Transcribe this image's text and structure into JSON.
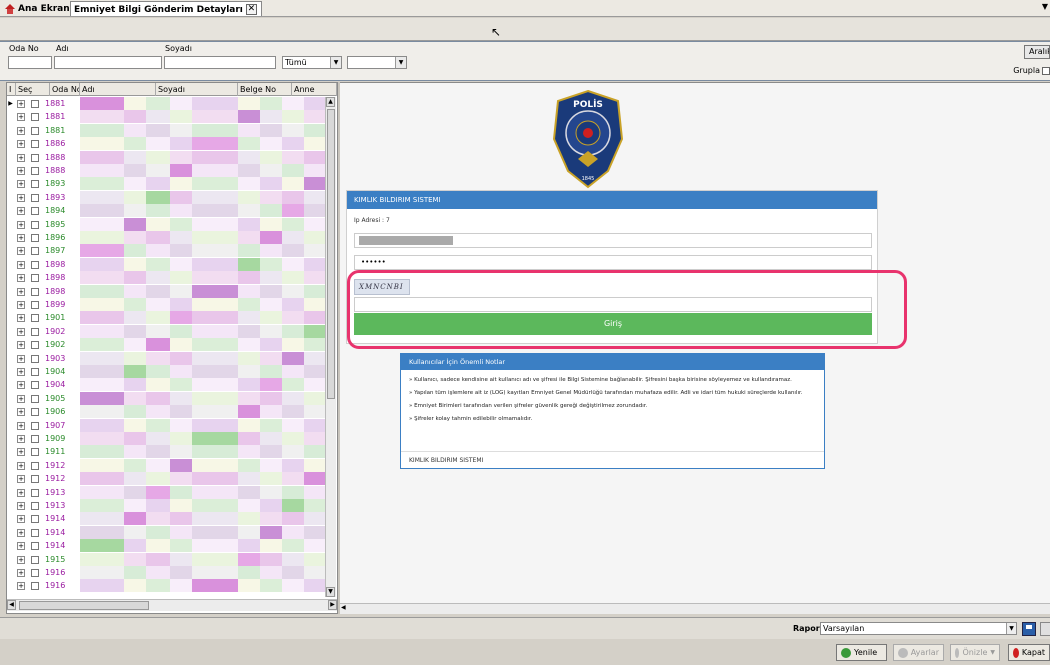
{
  "tabs": [
    {
      "label": "Ana Ekran",
      "icon": "home-icon"
    },
    {
      "label": "Emniyet Bilgi Gönderim Detayları",
      "close": "✕"
    }
  ],
  "filters": {
    "labels": {
      "oda_no": "Oda No",
      "adi": "Adı",
      "soyadi": "Soyadı"
    },
    "status_select": "Tümü",
    "range_button": "Aralık",
    "group_label": "Grupla"
  },
  "grid": {
    "columns": [
      "Seç",
      "Oda No",
      "Adı",
      "Soyadı",
      "Belge No",
      "Anne"
    ],
    "room_numbers": [
      "1881",
      "1881",
      "1881",
      "1886",
      "1888",
      "1888",
      "1893",
      "1893",
      "1894",
      "1895",
      "1896",
      "1897",
      "1898",
      "1898",
      "1898",
      "1899",
      "1901",
      "1902",
      "1902",
      "1903",
      "1904",
      "1904",
      "1905",
      "1906",
      "1907",
      "1909",
      "1911",
      "1912",
      "1912",
      "1913",
      "1913",
      "1914",
      "1914",
      "1914",
      "1915",
      "1916",
      "1916"
    ],
    "room_colors": [
      "#9a1ba0",
      "#9a1ba0",
      "#2a8a2a",
      "#9a1ba0",
      "#9a1ba0",
      "#9a1ba0",
      "#2a8a2a",
      "#9a1ba0",
      "#2a8a2a",
      "#2a8a2a",
      "#2a8a2a",
      "#2a8a2a",
      "#9a1ba0",
      "#9a1ba0",
      "#9a1ba0",
      "#9a1ba0",
      "#2a8a2a",
      "#9a1ba0",
      "#2a8a2a",
      "#9a1ba0",
      "#2a8a2a",
      "#9a1ba0",
      "#2a8a2a",
      "#2a8a2a",
      "#9a1ba0",
      "#2a8a2a",
      "#2a8a2a",
      "#9a1ba0",
      "#9a1ba0",
      "#9a1ba0",
      "#9a1ba0",
      "#9a1ba0",
      "#9a1ba0",
      "#9a1ba0",
      "#2a8a2a",
      "#9a1ba0",
      "#9a1ba0"
    ]
  },
  "web": {
    "card_title": "KIMLIK BILDIRIM SISTEMI",
    "ip_label": "Ip Adresi : 7",
    "password_mask": "••••••",
    "captcha_text": "XMNCNBI",
    "login_button": "Giriş",
    "notes_title": "Kullanıcılar İçin Önemli Notlar",
    "notes": [
      "» Kullanıcı, sadece kendisine ait kullanıcı adı ve şifresi ile Bilgi Sistemine bağlanabilir. Şifresini başka birisine söyleyemez ve kullandıramaz.",
      "» Yapılan tüm işlemlere ait iz (LOG) kayıtları Emniyet Genel Müdürlüğü tarafından muhafaza edilir. Adli ve idari tüm hukuki süreçlerde kullanılır.",
      "» Emniyet Birimleri tarafından verilen şifreler güvenlik gereği değiştirilmez zorundadır.",
      "» Şifreler kolay tahmin edilebilir olmamalıdır."
    ],
    "notes_footer": "KIMLIK BILDIRIM SISTEMI",
    "badge_text": "POLİS",
    "badge_ring": "EMNİYET GENEL MÜDÜRLÜĞÜ",
    "badge_year": "1845"
  },
  "report": {
    "label": "Rapor",
    "selected": "Varsayılan"
  },
  "actions": {
    "refresh": "Yenile",
    "settings": "Ayarlar",
    "preview": "Önizle",
    "close": "Kapat"
  }
}
